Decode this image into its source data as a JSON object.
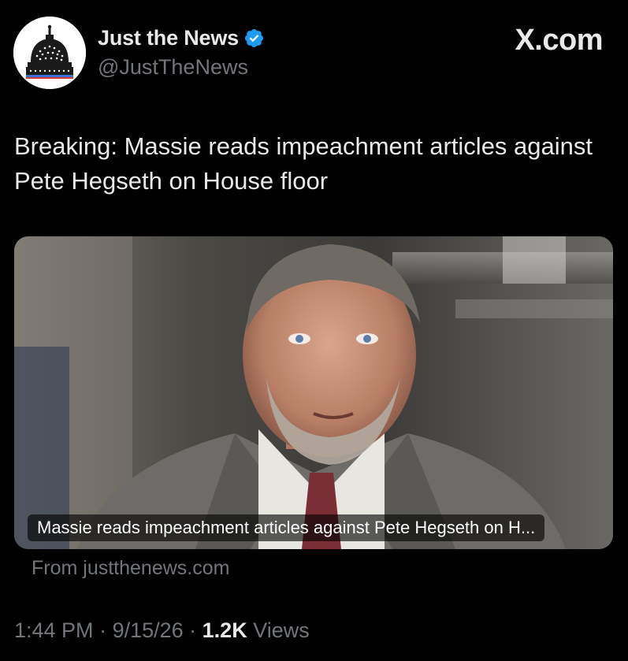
{
  "author": {
    "display_name": "Just the News",
    "handle": "@JustTheNews",
    "verified": true,
    "avatar_icon": "capitol-dome-icon",
    "verified_color": "#1d9bf0"
  },
  "brand": {
    "label": "X.com"
  },
  "tweet": {
    "text": "Breaking: Massie reads impeachment articles against Pete Hegseth on House floor"
  },
  "card": {
    "caption": "Massie reads impeachment articles against Pete Hegseth on H...",
    "source": "From justthenews.com",
    "image_icon": "news-photo"
  },
  "meta": {
    "time": "1:44 PM",
    "separator1": " · ",
    "date": "9/15/26",
    "separator2": " · ",
    "views_count": "1.2K",
    "views_label": " Views"
  },
  "colors": {
    "background": "#000000",
    "primary_text": "#e7e9ea",
    "secondary_text": "#71767b",
    "accent": "#1d9bf0"
  }
}
